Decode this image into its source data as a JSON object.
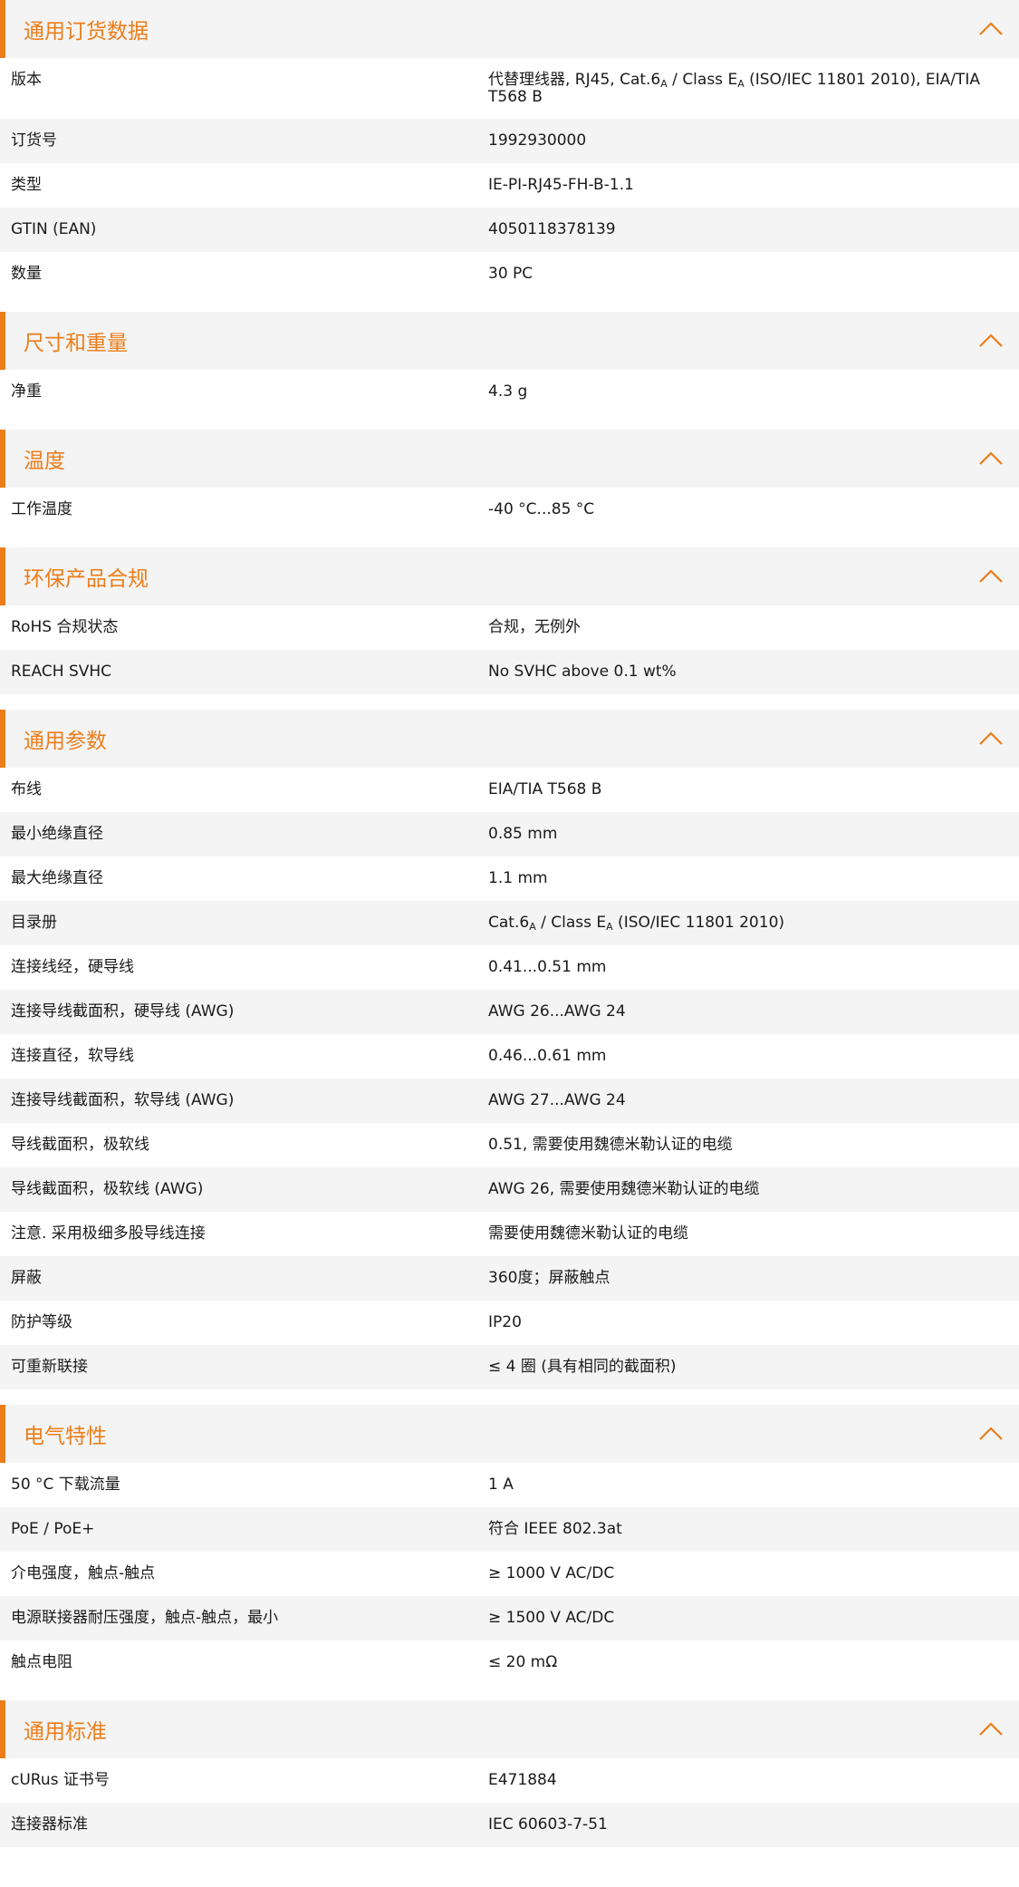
{
  "accent_color": "#ec7d1a",
  "header_bg": "#f4f4f4",
  "row_alt_bg": "#f4f4f4",
  "toggle_icon": "chevron-up-icon",
  "sections": [
    {
      "id": "ordering",
      "title": "通用订货数据",
      "rows": [
        {
          "label": "版本",
          "value": [
            [
              "t",
              "代替理线器, RJ45, Cat.6"
            ],
            [
              "s",
              "A"
            ],
            [
              "t",
              " / Class E"
            ],
            [
              "s",
              "A"
            ],
            [
              "t",
              " (ISO/IEC 11801 2010), EIA/TIA T568 B"
            ]
          ],
          "multi": true
        },
        {
          "label": "订货号",
          "value": "1992930000"
        },
        {
          "label": "类型",
          "value": "IE-PI-RJ45-FH-B-1.1"
        },
        {
          "label": "GTIN (EAN)",
          "value": "4050118378139"
        },
        {
          "label": "数量",
          "value": "30  PC"
        }
      ]
    },
    {
      "id": "dimensions",
      "title": "尺寸和重量",
      "rows": [
        {
          "label": "净重",
          "value": "4.3  g"
        }
      ]
    },
    {
      "id": "temperature",
      "title": "温度",
      "rows": [
        {
          "label": "工作温度",
          "value": "-40 °C...85 °C"
        }
      ]
    },
    {
      "id": "environmental",
      "title": "环保产品合规",
      "rows": [
        {
          "label": "RoHS 合规状态",
          "value": "合规，无例外"
        },
        {
          "label": "REACH SVHC",
          "value": "No SVHC above 0.1 wt%"
        }
      ]
    },
    {
      "id": "general",
      "title": "通用参数",
      "rows": [
        {
          "label": "布线",
          "value": "EIA/TIA T568 B"
        },
        {
          "label": "最小绝缘直径",
          "value": "0.85  mm"
        },
        {
          "label": "最大绝缘直径",
          "value": "1.1  mm"
        },
        {
          "label": "目录册",
          "value": [
            [
              "t",
              "Cat.6"
            ],
            [
              "s",
              "A"
            ],
            [
              "t",
              " / Class E"
            ],
            [
              "s",
              "A"
            ],
            [
              "t",
              " (ISO/IEC 11801 2010)"
            ]
          ]
        },
        {
          "label": "连接线经，硬导线",
          "value": "0.41...0.51 mm"
        },
        {
          "label": "连接导线截面积，硬导线 (AWG)",
          "value": "AWG 26...AWG 24"
        },
        {
          "label": "连接直径，软导线",
          "value": "0.46...0.61 mm"
        },
        {
          "label": "连接导线截面积，软导线 (AWG)",
          "value": "AWG 27...AWG 24"
        },
        {
          "label": "导线截面积，极软线",
          "value": "0.51, 需要使用魏德米勒认证的电缆"
        },
        {
          "label": "导线截面积，极软线 (AWG)",
          "value": "AWG 26, 需要使用魏德米勒认证的电缆"
        },
        {
          "label": "注意. 采用极细多股导线连接",
          "value": "需要使用魏德米勒认证的电缆"
        },
        {
          "label": "屏蔽",
          "value": "360度；屏蔽触点"
        },
        {
          "label": "防护等级",
          "value": "IP20"
        },
        {
          "label": "可重新联接",
          "value": "≤ 4 圈 (具有相同的截面积)"
        }
      ]
    },
    {
      "id": "electrical",
      "title": "电气特性",
      "rows": [
        {
          "label": "50 °C 下载流量",
          "value": "1  A"
        },
        {
          "label": "PoE / PoE+",
          "value": "符合 IEEE 802.3at"
        },
        {
          "label": "介电强度，触点-触点",
          "value": "≥ 1000 V AC/DC"
        },
        {
          "label": "电源联接器耐压强度，触点-触点，最小",
          "value": "≥ 1500 V AC/DC"
        },
        {
          "label": "触点电阻",
          "value": "≤ 20 mΩ"
        }
      ]
    },
    {
      "id": "standards",
      "title": "通用标准",
      "rows": [
        {
          "label": "cURus 证书号",
          "value": "E471884"
        },
        {
          "label": "连接器标准",
          "value": "IEC 60603-7-51"
        }
      ]
    }
  ]
}
